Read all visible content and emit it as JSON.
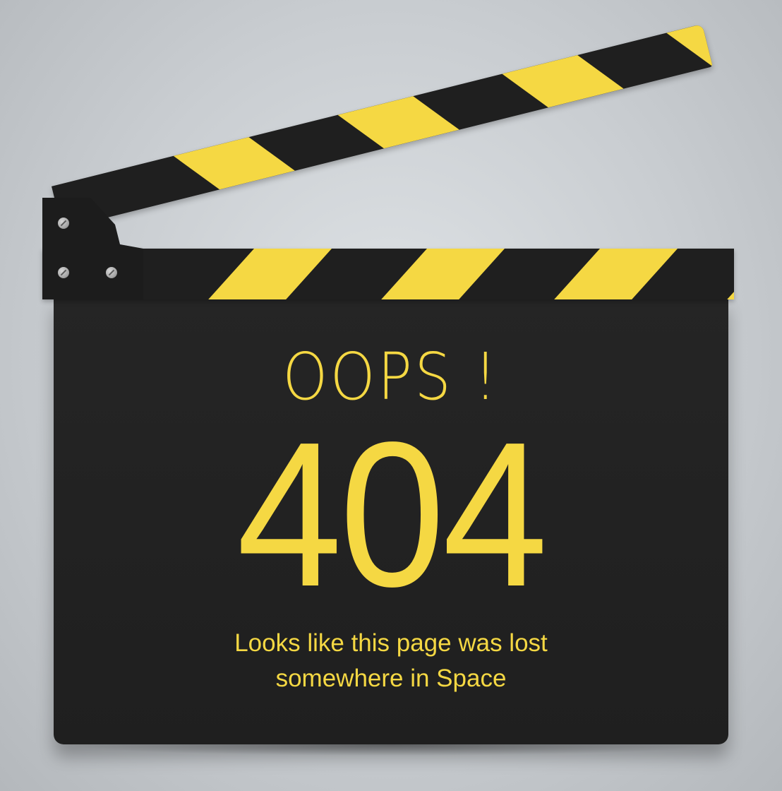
{
  "colors": {
    "accent": "#f5d843",
    "board": "#222222",
    "background": "#cfd3d6",
    "screw": "#a8a8a8"
  },
  "content": {
    "headline": "OOPS !",
    "error_code": "404",
    "message_line1": "Looks like this page was lost",
    "message_line2": "somewhere in Space"
  },
  "icons": {
    "clapperboard": "clapperboard-icon",
    "screw": "screw-icon"
  }
}
